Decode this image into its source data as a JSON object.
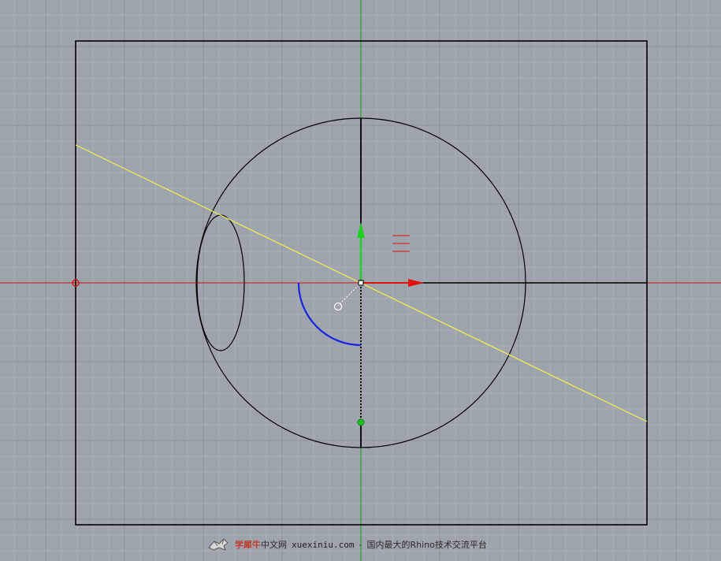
{
  "viewport": {
    "background": "#9ea4ad",
    "grid_minor_color": "#a9afb8",
    "grid_major_color": "#8d939c",
    "x_axis_color": "#d01010",
    "y_axis_color": "#10a010",
    "curve_color": "#000000",
    "construction_line_color": "#f2f24a",
    "arc_color": "#1a22e0",
    "gumball_x_color": "#e01010",
    "gumball_y_color": "#20d020",
    "gumball_z_color": "#e01010"
  },
  "watermark": {
    "icon": "logo-icon",
    "brand": "学犀牛",
    "brand_suffix": "中文网",
    "site": "xuexiniu.com",
    "separator": "-",
    "tagline": "国内最大的Rhino技术交流平台"
  }
}
